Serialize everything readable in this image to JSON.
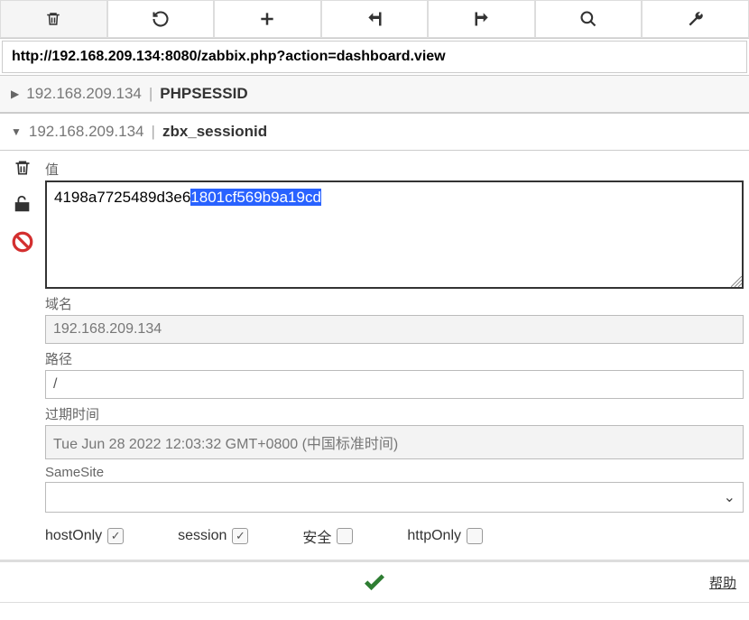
{
  "url": "http://192.168.209.134:8080/zabbix.php?action=dashboard.view",
  "cookies": [
    {
      "host": "192.168.209.134",
      "name": "PHPSESSID",
      "expanded": false
    },
    {
      "host": "192.168.209.134",
      "name": "zbx_sessionid",
      "expanded": true
    }
  ],
  "labels": {
    "value": "值",
    "domain": "域名",
    "path": "路径",
    "expires": "过期时间",
    "samesite": "SameSite",
    "hostonly": "hostOnly",
    "session": "session",
    "secure": "安全",
    "httponly": "httpOnly",
    "help": "帮助"
  },
  "detail": {
    "value_plain": "4198a7725489d3e6",
    "value_selected": "1801cf569b9a19cd",
    "domain": "192.168.209.134",
    "path": "/",
    "expires": "Tue Jun 28 2022 12:03:32 GMT+0800 (中国标准时间)",
    "samesite": "",
    "hostOnly": true,
    "session": true,
    "secure": false,
    "httpOnly": false
  }
}
